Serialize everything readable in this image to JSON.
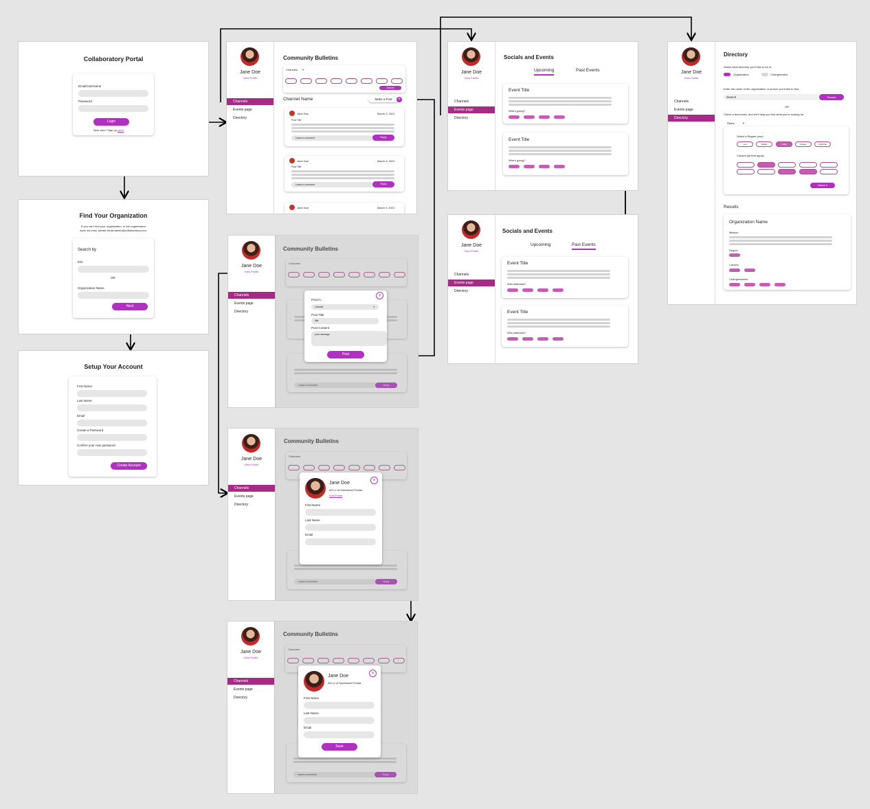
{
  "login": {
    "title": "Collaboratory Portal",
    "email_label": "Email/Username",
    "password_label": "Password",
    "login_button": "Login",
    "new_prompt": "New user? Sign up ",
    "signup_link": "here!"
  },
  "find_org": {
    "title": "Find Your Organization",
    "desc_line1": "If you can't find your organization, or the organization",
    "desc_line2": "does not exist, please email admin@collaboratory.com.",
    "search_by": "Search by",
    "ein_label": "EIN",
    "or_label": "OR",
    "org_name_label": "Organization Name",
    "next_button": "Next"
  },
  "setup": {
    "title": "Setup Your Account",
    "first_name": "First Name",
    "last_name": "Last Name",
    "email": "Email",
    "create_password": "Create a Password",
    "confirm_password": "Confirm your new password",
    "create_button": "Create Account"
  },
  "profile": {
    "name": "Jane Doe",
    "view_profile": "View Profile",
    "org": "ACLU of Southwest Florida",
    "edit_profile": "Edit Profile"
  },
  "nav": {
    "channels": "Channels",
    "events": "Events page",
    "directory": "Directory"
  },
  "bulletins": {
    "title": "Community Bulletins",
    "channels_dropdown": "Channels",
    "search_button": "Search",
    "channel_name": "Channel Name",
    "make_post": "Make a Post",
    "post_author": "Jane Doe",
    "post_date": "March 3, 2021",
    "post_title": "Post Title",
    "comment_placeholder": "Leave a comment",
    "reply_button": "Reply"
  },
  "post_modal": {
    "post_in": "Post in...",
    "channel_value": "channel",
    "post_title_label": "Post Title",
    "title_value": "title",
    "post_content_label": "Post Content",
    "content_value": "post message",
    "post_button": "Post"
  },
  "edit_modal": {
    "first_name": "First Name",
    "last_name": "Last Name",
    "email": "Email",
    "save_button": "Save"
  },
  "events": {
    "title": "Socials and Events",
    "tab_upcoming": "Upcoming",
    "tab_past": "Past Events",
    "event_title": "Event Title",
    "whos_going": "Who's going?",
    "who_attended": "Who attended?"
  },
  "directory": {
    "title": "Directory",
    "select_prompt": "Select what directory you'd like to be in.",
    "opt_org": "Organization",
    "opt_changemaker": "Changemaker",
    "enter_name": "Enter the name of the organization or person you'd like to find.",
    "search_placeholder": "Search",
    "search_button": "Search",
    "or_label": "OR",
    "check_boxes": "Check a few boxes, and we'll help you find what you're looking for.",
    "filters": "Filters",
    "region_label": "Select a Region (one)",
    "regions": [
      "Lee",
      "Naples",
      "Collier",
      "Glades",
      "Charlotte"
    ],
    "causes_label": "Causes (all that apply)",
    "search_it": "Search it",
    "results": "Results",
    "org_name": "Organization Name",
    "mission": "Mission",
    "region": "Region",
    "causes": "Causes",
    "changemakers": "Changemakers"
  },
  "colors": {
    "accent": "#b030c0",
    "nav_active": "#a52b87",
    "pill": "#c85ab8"
  }
}
